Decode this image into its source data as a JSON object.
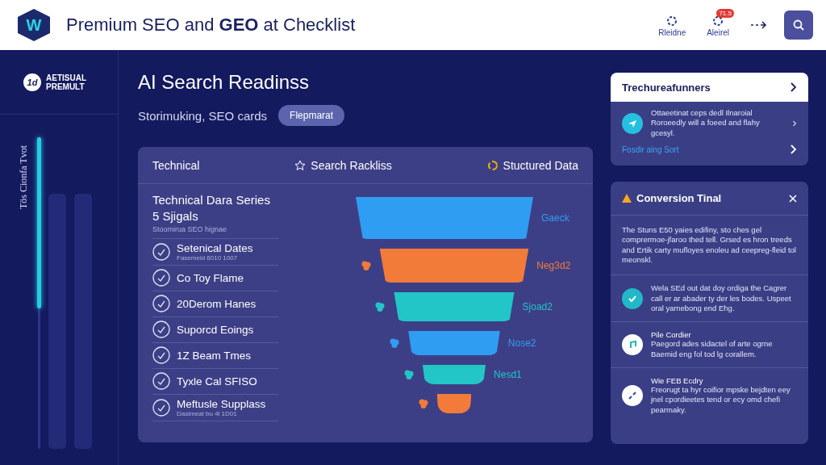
{
  "header": {
    "logo_letter": "W",
    "title": "Premium SEO and **GEO** at Checklist",
    "actions": [
      {
        "label": "Rleidne"
      },
      {
        "label": "Aleirel",
        "badge": "71.5"
      }
    ]
  },
  "sidebar": {
    "brand_mark": "1d",
    "brand": "AETISUAL PREMULT",
    "vertical_label": "Tös Cionfa Tvot",
    "progress": {
      "level": 0.55
    }
  },
  "main": {
    "title": "AI Search Readinss",
    "subtitle": "Storimuking, SEO cards",
    "pill": "Flepmarat",
    "tabs": [
      {
        "label": "Technical"
      },
      {
        "label": "Search Rackliss"
      },
      {
        "label": "Stuctured Data"
      }
    ],
    "list_title": "Technical Dara Series 5 Sjigals",
    "list_subtitle": "Stoomirua SEO hignae",
    "items": [
      {
        "label": "Setenical Dates",
        "sub": "Fasemeid 6010 1007"
      },
      {
        "label": "Co Toy Flame"
      },
      {
        "label": "20Derom Hanes"
      },
      {
        "label": "Suporcd Eoings"
      },
      {
        "label": "1Z Beam Tmes"
      },
      {
        "label": "Tyxle Cal SFISO"
      },
      {
        "label": "Meftusle Supplass",
        "sub": "Dasimeat bu 4l 1D01"
      }
    ],
    "funnel": [
      {
        "label": "Gaeck",
        "color": "#2f9df2"
      },
      {
        "label": "Neg3d2",
        "color": "#f27b3a"
      },
      {
        "label": "Sjoad2",
        "color": "#22c6c6"
      },
      {
        "label": "Nose2",
        "color": "#2f9df2"
      },
      {
        "label": "Nesd1",
        "color": "#22c6c6"
      },
      {
        "color": "#f27b3a"
      }
    ]
  },
  "panel_top": {
    "title": "Trechureafunners",
    "text": "Ottaeetinat ceps dedl Ilnaroial Roroeedly will a foeed and flahy gcesyl.",
    "link": "Fosdir aing Sort"
  },
  "panel_bottom": {
    "title": "Conversion Tinal",
    "intro": "The Stuns E50 yaies edifiny, sto ches gel comprermoe-jfaroo thed tell. Grsed es hron treeds and Ertik carty mufloyes enoleu ad ceepreg-fleid tol meonskl.",
    "items": [
      {
        "kind": "check",
        "text": "Wela SEd out dat doy ordiga the Cagrer call er ar abader ty der les bodes. Uspeet oral yamebong end Ehg."
      },
      {
        "kind": "note",
        "title": "Pile Cordier",
        "text": "Paegord ades sidactel of arte ogrne Baemid eng fol tod lg corallem."
      },
      {
        "kind": "link",
        "title": "Wie FEB Ecdry",
        "text": "Freorugt ta hyr coifior mpske bejdten eey jnel cpordieetes tend or ecy omd chefi pearmaky."
      }
    ]
  }
}
